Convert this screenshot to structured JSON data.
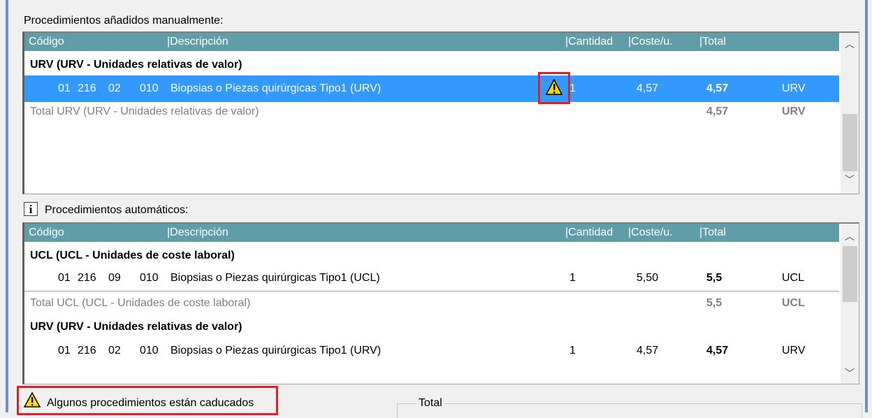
{
  "manual": {
    "label": "Procedimientos añadidos manualmente:",
    "columns": {
      "codigo": "Código",
      "descripcion": "|Descripción",
      "cantidad": "|Cantidad",
      "coste": "|Coste/u.",
      "total": "|Total"
    },
    "group": "URV (URV - Unidades relativas de valor)",
    "row": {
      "c1": "01",
      "c2": "216",
      "c3": "02",
      "c4": "010",
      "desc": "Biopsias o Piezas quirúrgicas Tipo1 (URV)",
      "cantidad": "1",
      "coste": "4,57",
      "total": "4,57",
      "unit": "URV"
    },
    "total_row": {
      "label": "Total URV (URV - Unidades relativas de valor)",
      "total": "4,57",
      "unit": "URV"
    },
    "warning_icon": "warning-triangle-icon"
  },
  "auto": {
    "label": "Procedimientos automáticos:",
    "info_glyph": "i",
    "columns": {
      "codigo": "Código",
      "descripcion": "|Descripción",
      "cantidad": "|Cantidad",
      "coste": "|Coste/u.",
      "total": "|Total"
    },
    "group1": "UCL (UCL - Unidades de coste laboral)",
    "row1": {
      "c1": "01",
      "c2": "216",
      "c3": "09",
      "c4": "010",
      "desc": "Biopsias o Piezas quirúrgicas Tipo1 (UCL)",
      "cantidad": "1",
      "coste": "5,50",
      "total": "5,5",
      "unit": "UCL"
    },
    "total1": {
      "label": "Total UCL (UCL - Unidades de coste laboral)",
      "total": "5,5",
      "unit": "UCL"
    },
    "group2": "URV (URV - Unidades relativas de valor)",
    "row2": {
      "c1": "01",
      "c2": "216",
      "c3": "02",
      "c4": "010",
      "desc": "Biopsias o Piezas quirúrgicas Tipo1 (URV)",
      "cantidad": "1",
      "coste": "4,57",
      "total": "4,57",
      "unit": "URV"
    }
  },
  "footer": {
    "warning_text": "Algunos procedimientos están caducados",
    "total_group_label": "Total"
  },
  "colors": {
    "header": "#5f9ea8",
    "selection": "#3399ff",
    "highlight": "#e0202c",
    "warning": "#ffd700"
  }
}
